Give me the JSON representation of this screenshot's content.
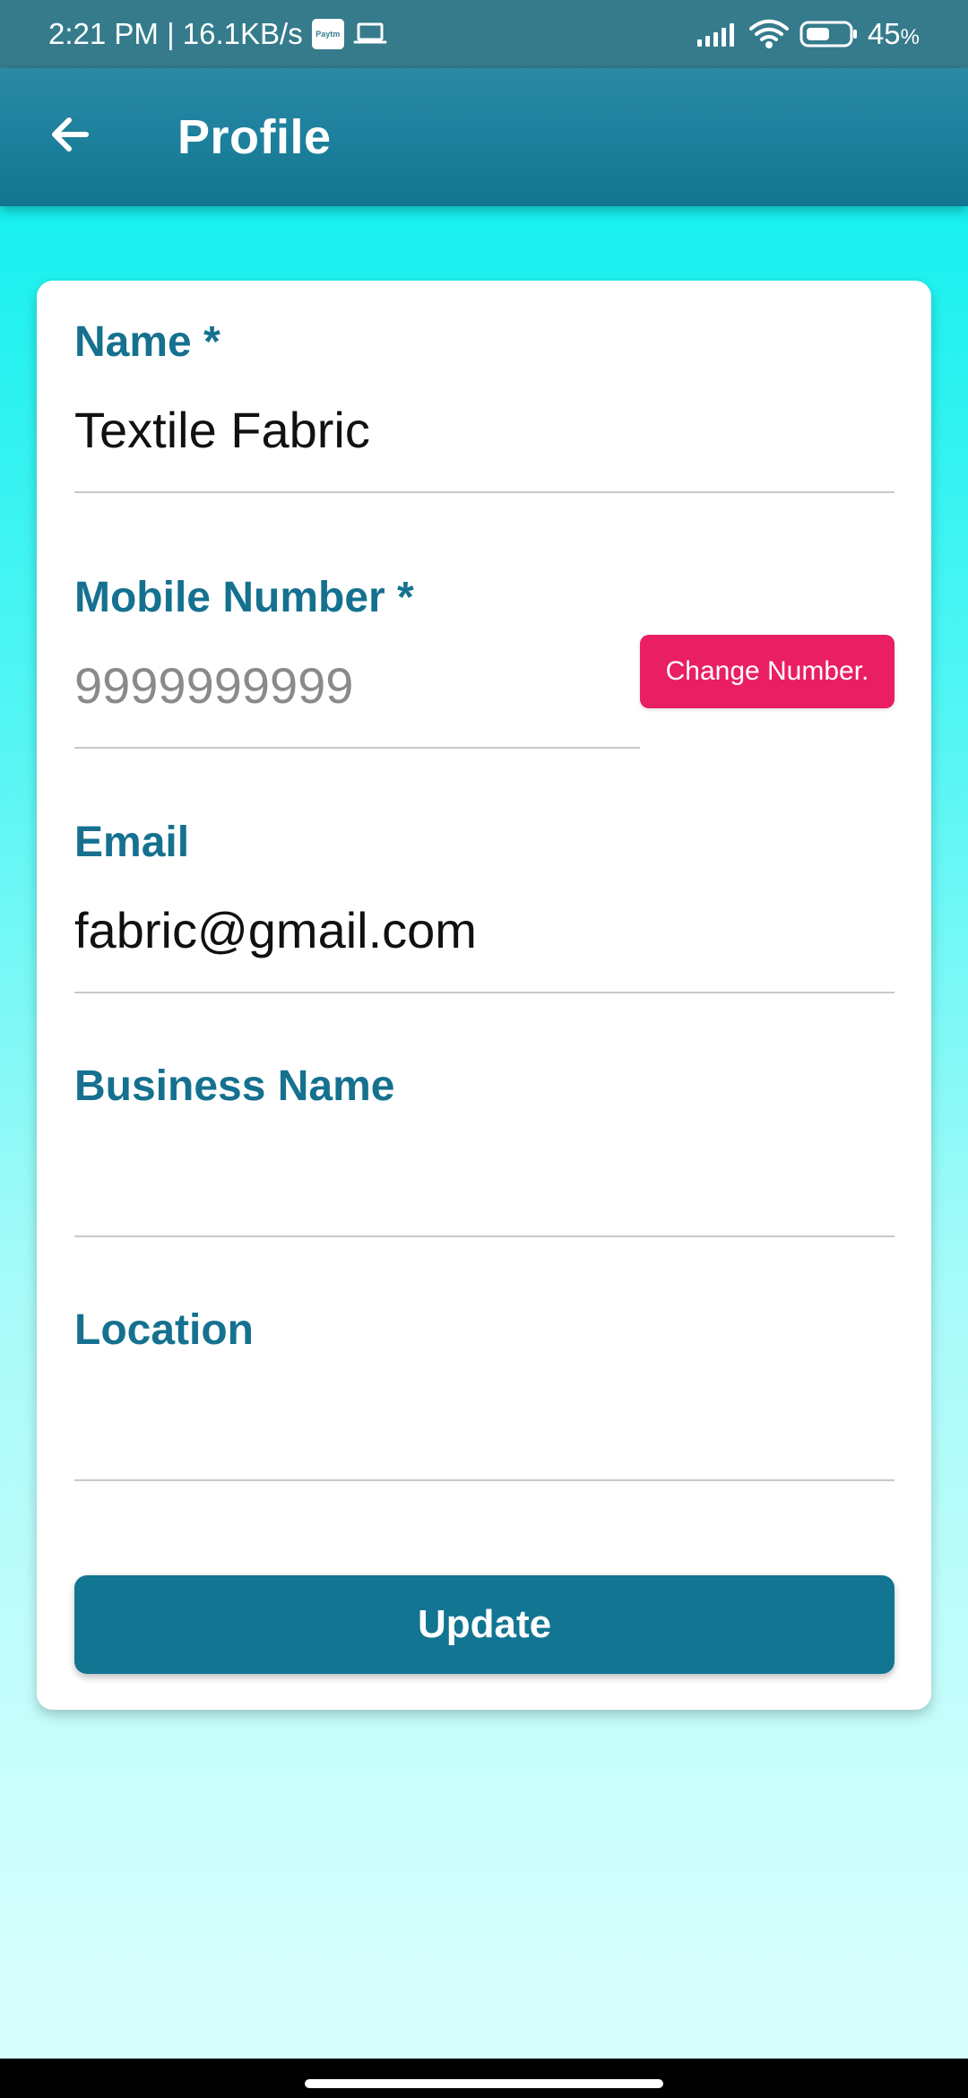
{
  "status_bar": {
    "time_network": "2:21 PM | 16.1KB/s",
    "paytm_text": "Paytm",
    "battery": "45",
    "battery_symbol": "%"
  },
  "app_bar": {
    "title": "Profile",
    "back_icon": "arrow-left-icon"
  },
  "form": {
    "name": {
      "label": "Name *",
      "value": "Textile Fabric"
    },
    "mobile": {
      "label": "Mobile Number *",
      "value": "9999999999",
      "change_button": "Change Number."
    },
    "email": {
      "label": "Email",
      "value": "fabric@gmail.com"
    },
    "business_name": {
      "label": "Business Name",
      "value": ""
    },
    "location": {
      "label": "Location",
      "value": ""
    },
    "update_button": "Update"
  },
  "colors": {
    "app_bar": "#117691",
    "accent": "#15718f",
    "change_button": "#e91e63",
    "background_top": "#13eeee",
    "background_bottom": "#d8fffd"
  },
  "icons": [
    "paytm-icon",
    "laptop-icon",
    "signal-icon",
    "wifi-icon",
    "battery-icon",
    "arrow-left-icon"
  ]
}
